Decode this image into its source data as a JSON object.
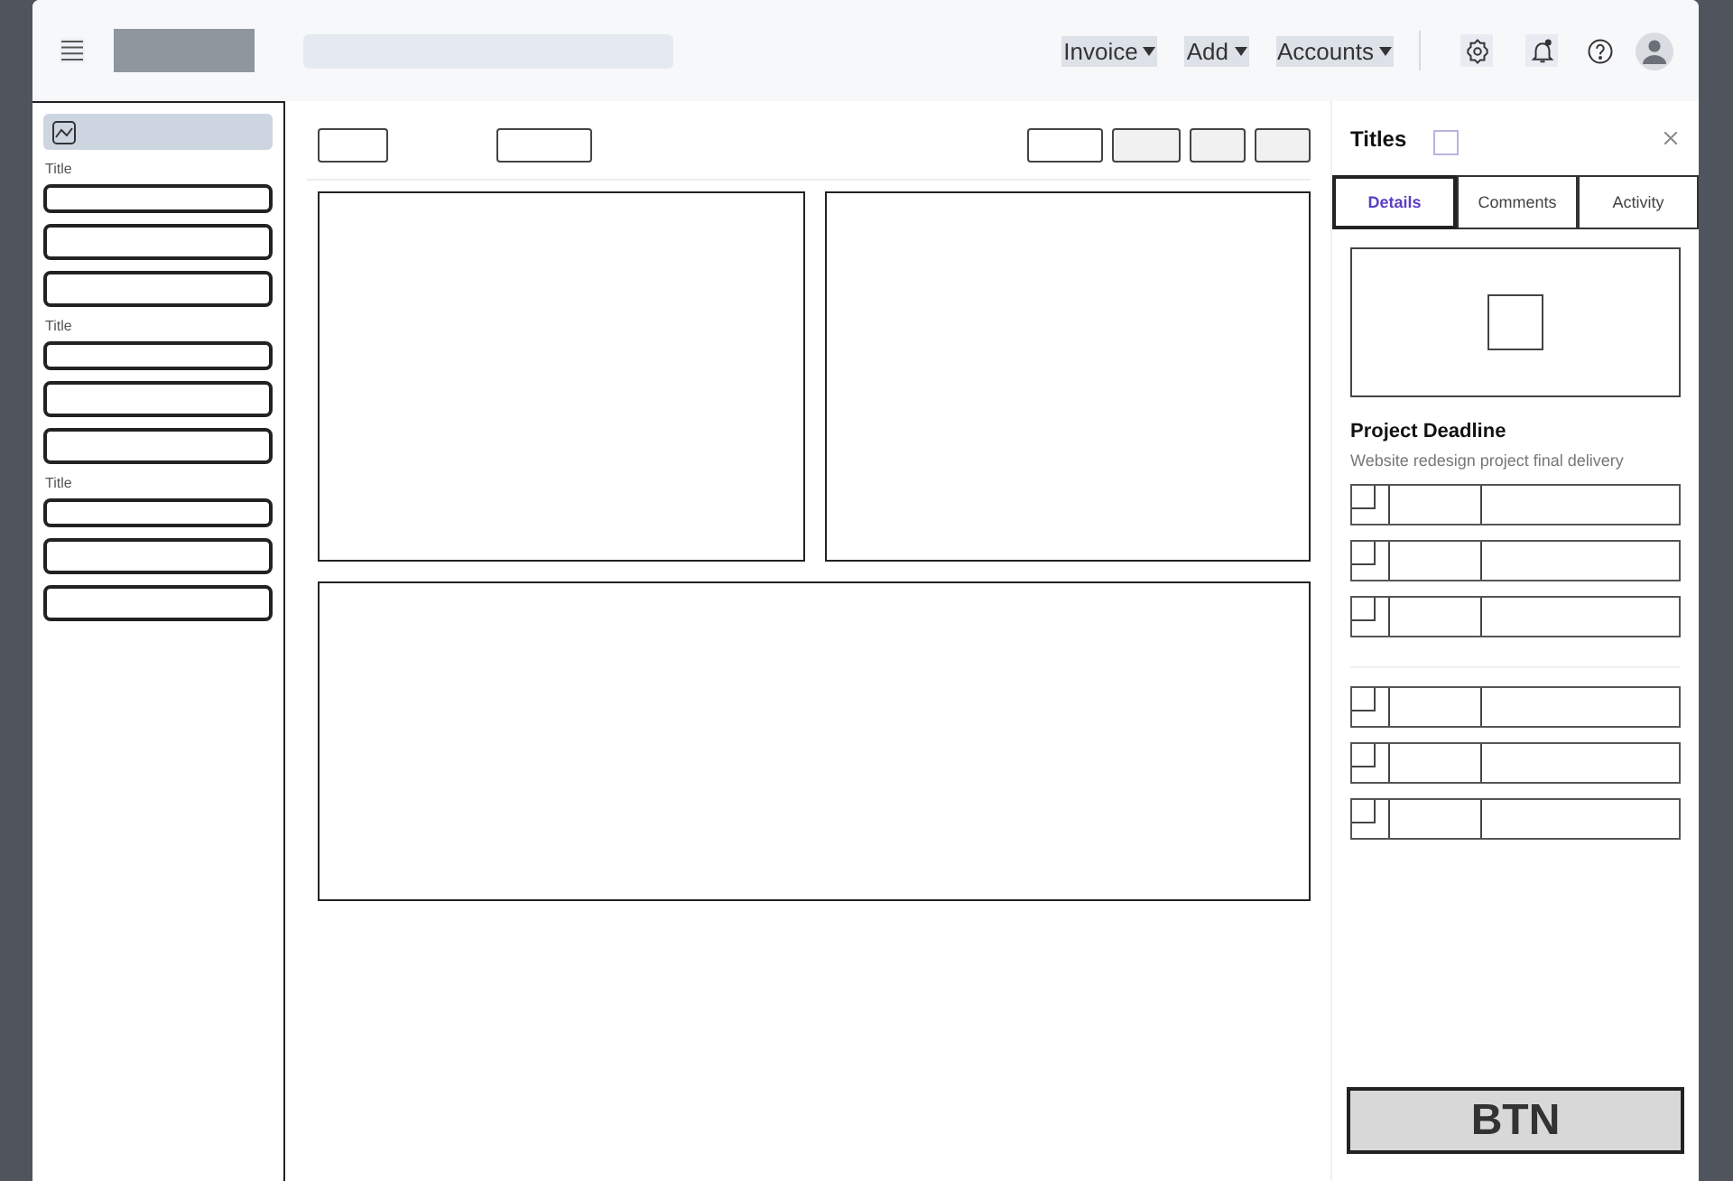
{
  "header": {
    "menus": [
      {
        "label": "Invoice",
        "selected": true
      },
      {
        "label": "Add",
        "selected": true
      },
      {
        "label": "Accounts",
        "selected": true
      }
    ]
  },
  "sidebar": {
    "top_item": {
      "selected": true
    },
    "sections": [
      {
        "title": "Title"
      },
      {
        "title": "Title"
      },
      {
        "title": "Title"
      }
    ]
  },
  "panel": {
    "title": "Titles",
    "tabs": [
      {
        "label": "Details",
        "selected": true
      },
      {
        "label": "Comments",
        "selected": false
      },
      {
        "label": "Activity",
        "selected": false
      }
    ],
    "heading": "Project Deadline",
    "description": "Website redesign project final delivery",
    "row_groups": [
      [
        {
          "checked": false
        },
        {
          "checked": false
        },
        {
          "checked": false
        }
      ],
      [
        {
          "checked": false
        },
        {
          "checked": false
        },
        {
          "checked": false
        }
      ]
    ],
    "button": "BTN"
  }
}
